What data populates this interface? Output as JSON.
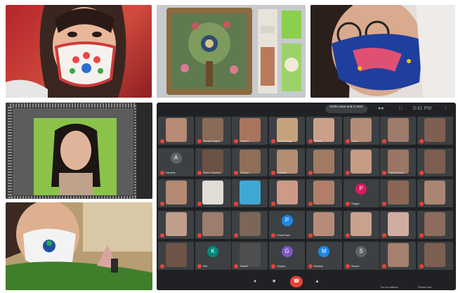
{
  "photos": [
    {
      "id": "mask-flower-photo"
    },
    {
      "id": "tree-decor-photo"
    },
    {
      "id": "painted-mask-photo"
    },
    {
      "id": "photo-frame-photo"
    },
    {
      "id": "peacock-mask-photo"
    }
  ],
  "meet": {
    "header_pill": "Anshu Kaur and 2 more",
    "time": "5:41 PM",
    "participants": [
      {
        "name": "",
        "type": "photo",
        "color": "#b88a73"
      },
      {
        "name": "Sandra Rajput",
        "type": "photo",
        "color": "#8a6a58"
      },
      {
        "name": "Rashmi",
        "type": "photo",
        "color": "#a8745e"
      },
      {
        "name": "Radha Singh",
        "type": "photo",
        "color": "#c4a27c"
      },
      {
        "name": "Srishti",
        "type": "photo",
        "color": "#caa08b"
      },
      {
        "name": "Gauri",
        "type": "photo",
        "color": "#b48b76"
      },
      {
        "name": "",
        "type": "photo",
        "color": "#9c7b6b"
      },
      {
        "name": "",
        "type": "photo",
        "color": "#7f5f50"
      },
      {
        "name": "Kanishk",
        "type": "avatar",
        "letter": "A",
        "color": "#5f6368"
      },
      {
        "name": "Gauri Chauhan",
        "type": "photo",
        "color": "#6b5246"
      },
      {
        "name": "Garima",
        "type": "photo",
        "color": "#8f6e5a"
      },
      {
        "name": "Anshika",
        "type": "photo",
        "color": "#b58d73"
      },
      {
        "name": "",
        "type": "photo",
        "color": "#a07a63"
      },
      {
        "name": "",
        "type": "photo",
        "color": "#c69c85"
      },
      {
        "name": "Priya Sharma",
        "type": "photo",
        "color": "#9a7665"
      },
      {
        "name": "",
        "type": "photo",
        "color": "#7d5e50"
      },
      {
        "name": "",
        "type": "photo",
        "color": "#b58a72"
      },
      {
        "name": "",
        "type": "photo",
        "color": "#e2dcd7"
      },
      {
        "name": "",
        "type": "photo",
        "color": "#3fa9d6"
      },
      {
        "name": "",
        "type": "photo",
        "color": "#cc9a86"
      },
      {
        "name": "",
        "type": "photo",
        "color": "#b07e6a"
      },
      {
        "name": "Pragya",
        "type": "avatar",
        "letter": "P",
        "color": "#d81b60"
      },
      {
        "name": "",
        "type": "photo",
        "color": "#8b6656"
      },
      {
        "name": "",
        "type": "photo",
        "color": "#a98572"
      },
      {
        "name": "",
        "type": "photo",
        "color": "#c19e8c"
      },
      {
        "name": "",
        "type": "photo",
        "color": "#9c7d6e"
      },
      {
        "name": "",
        "type": "photo",
        "color": "#7c6559"
      },
      {
        "name": "Preeti Rani",
        "type": "avatar",
        "letter": "P",
        "color": "#1e88e5"
      },
      {
        "name": "",
        "type": "photo",
        "color": "#b68c78"
      },
      {
        "name": "",
        "type": "photo",
        "color": "#c9a18f"
      },
      {
        "name": "",
        "type": "photo",
        "color": "#d0ada0"
      },
      {
        "name": "",
        "type": "photo",
        "color": "#8d6b5d"
      },
      {
        "name": "",
        "type": "photo",
        "color": "#6e5448"
      },
      {
        "name": "Kirti",
        "type": "avatar",
        "letter": "K",
        "color": "#00897b"
      },
      {
        "name": "Sakshi",
        "type": "photo",
        "color": "#4e4e4e"
      },
      {
        "name": "Gunjan",
        "type": "avatar",
        "letter": "G",
        "color": "#7e57c2"
      },
      {
        "name": "Muskan",
        "type": "avatar",
        "letter": "M",
        "color": "#1e88e5"
      },
      {
        "name": "Simran",
        "type": "avatar",
        "letter": "S",
        "color": "#5f6368"
      },
      {
        "name": "",
        "type": "photo",
        "color": "#a6806e"
      },
      {
        "name": "",
        "type": "photo",
        "color": "#7d5f51"
      }
    ],
    "bottom": {
      "captions": "Turn on captions",
      "present": "Present now"
    }
  }
}
